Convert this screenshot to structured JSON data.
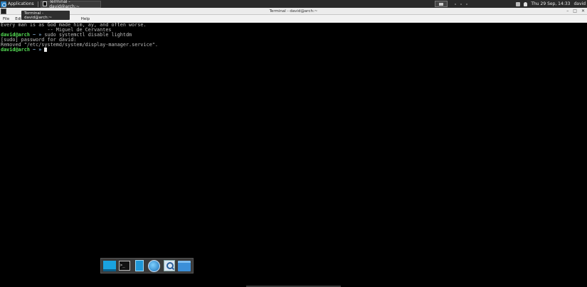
{
  "panel": {
    "applications_label": "Applications",
    "task_title": "Terminal - david@arch:~",
    "clock": "Thu 29 Sep, 14:33",
    "user": "david"
  },
  "window": {
    "title": "Terminal - david@arch:~",
    "tooltip": "Terminal - david@arch:~",
    "controls": [
      "–",
      "□",
      "✕"
    ]
  },
  "menu": {
    "file": "File",
    "edit": "Edi",
    "help": "Help"
  },
  "terminal": {
    "lines": [
      "Every man is as God made him, ay, and often worse.",
      "                -- Miguel de Cervantes"
    ],
    "prompt_user": "david@arch",
    "prompt_sym": " ~ » ",
    "cmd1": "sudo systemctl disable lightdm",
    "sudo_prompt": "[sudo] password for david:",
    "removed": "Removed \"/etc/systemd/system/display-manager.service\"."
  },
  "dock": {
    "items": [
      "show-desktop-icon",
      "terminal-icon",
      "file-icon",
      "web-browser-icon",
      "app-finder-icon",
      "file-manager-icon"
    ]
  }
}
